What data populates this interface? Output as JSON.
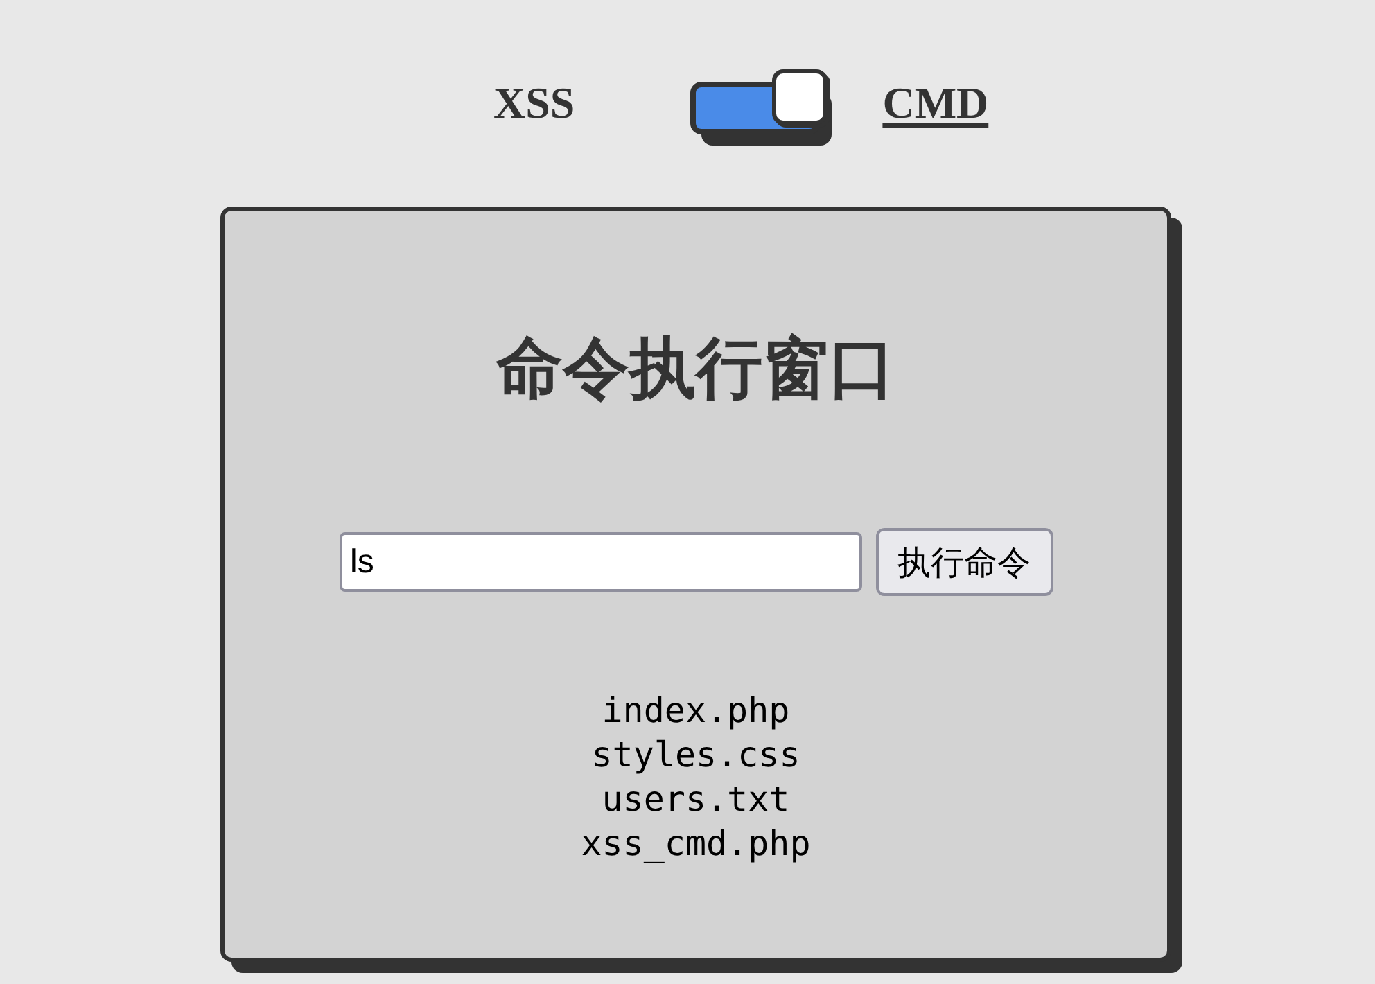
{
  "mode_switch": {
    "options": [
      {
        "label": "XSS",
        "selected": false
      },
      {
        "label": "CMD",
        "selected": true
      }
    ],
    "on": true
  },
  "panel": {
    "title": "命令执行窗口",
    "command_input": {
      "value": "ls"
    },
    "run_button": "执行命令",
    "output_lines": [
      "index.php",
      "styles.css",
      "users.txt",
      "xss_cmd.php"
    ]
  }
}
